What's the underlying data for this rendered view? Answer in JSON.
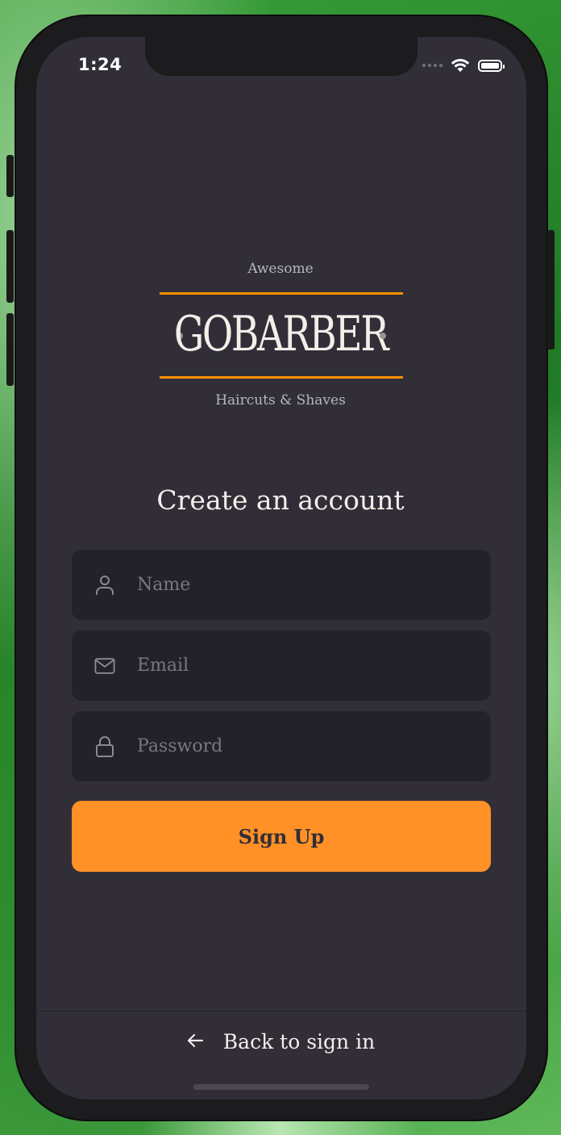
{
  "status_bar": {
    "time": "1:24"
  },
  "logo": {
    "top_text": "Awesome",
    "brand": "GOBARBER",
    "sub_text": "Haircuts & Shaves"
  },
  "page_title": "Create an account",
  "form": {
    "name_placeholder": "Name",
    "email_placeholder": "Email",
    "password_placeholder": "Password",
    "submit_label": "Sign Up"
  },
  "footer": {
    "back_label": "Back to sign in"
  },
  "colors": {
    "accent": "#ff9000",
    "background": "#312e38",
    "input_bg": "#232129",
    "text": "#f4ede8"
  }
}
